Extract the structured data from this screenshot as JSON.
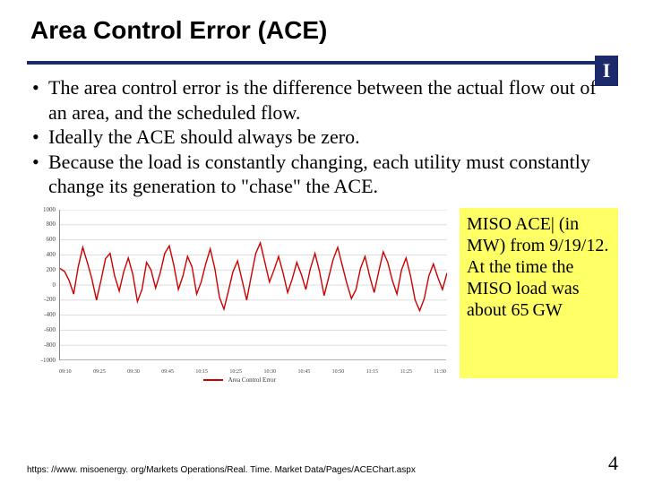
{
  "title": "Area Control Error (ACE)",
  "logo_letter": "I",
  "bullets": [
    "The area control error is the difference between the actual flow out of an area, and the scheduled flow.",
    "Ideally the ACE should always be zero.",
    "Because the load is constantly changing, each utility must constantly change its generation to \"chase\" the ACE."
  ],
  "note_text": "MISO ACE| (in MW) from 9/19/12.  At the time the MISO load was about 65 GW",
  "source_url": "https: //www. misoenergy. org/Markets Operations/Real. Time. Market Data/Pages/ACEChart.aspx",
  "page_number": "4",
  "chart_data": {
    "type": "line",
    "title": "",
    "xlabel": "",
    "ylabel": "",
    "ylim": [
      -1000,
      1000
    ],
    "y_ticks": [
      1000,
      800,
      600,
      400,
      200,
      0,
      -200,
      -400,
      -600,
      -800,
      -1000
    ],
    "x_ticks": [
      "09:10",
      "09:25",
      "09:30",
      "09:45",
      "10:15",
      "10:25",
      "10:30",
      "10:45",
      "10:50",
      "11:15",
      "11:25",
      "11:30"
    ],
    "series": [
      {
        "name": "Area Control Error",
        "color": "#cc0000",
        "values": [
          220,
          180,
          60,
          -120,
          240,
          500,
          300,
          80,
          -200,
          60,
          350,
          420,
          120,
          -80,
          180,
          360,
          140,
          -220,
          -60,
          300,
          200,
          -40,
          160,
          420,
          520,
          260,
          -60,
          120,
          380,
          240,
          -120,
          40,
          280,
          480,
          220,
          -160,
          -320,
          -80,
          180,
          320,
          60,
          -200,
          120,
          420,
          560,
          300,
          40,
          200,
          380,
          160,
          -100,
          80,
          300,
          140,
          -60,
          220,
          420,
          180,
          -140,
          100,
          340,
          500,
          260,
          20,
          -180,
          -60,
          220,
          380,
          120,
          -100,
          180,
          440,
          300,
          60,
          -120,
          200,
          360,
          120,
          -200,
          -340,
          -180,
          120,
          280,
          100,
          -60,
          160
        ]
      }
    ],
    "legend_label": "Area Control Error"
  }
}
